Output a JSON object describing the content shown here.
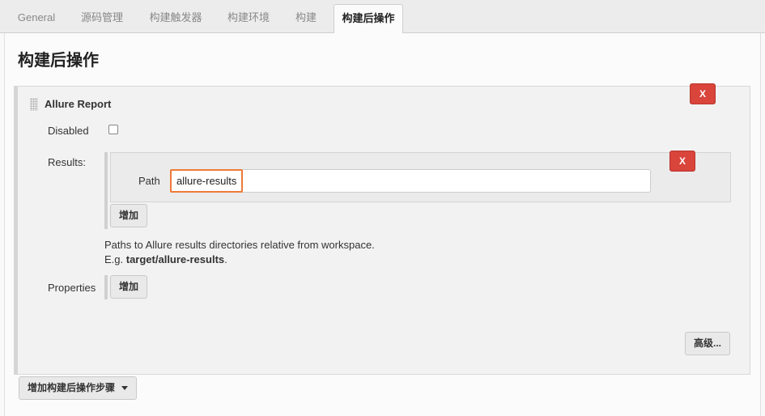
{
  "tabs": [
    {
      "label": "General",
      "active": false
    },
    {
      "label": "源码管理",
      "active": false
    },
    {
      "label": "构建触发器",
      "active": false
    },
    {
      "label": "构建环境",
      "active": false
    },
    {
      "label": "构建",
      "active": false
    },
    {
      "label": "构建后操作",
      "active": true
    }
  ],
  "section": {
    "title": "构建后操作"
  },
  "builder": {
    "title": "Allure Report",
    "delete_label": "X",
    "disabled_label": "Disabled",
    "disabled_checked": false,
    "results": {
      "label": "Results:",
      "delete_label": "X",
      "path_label": "Path",
      "path_value": "allure-results",
      "add_label": "增加",
      "help_line1": "Paths to Allure results directories relative from workspace.",
      "help_line2_prefix": "E.g. ",
      "help_line2_bold": "target/allure-results",
      "help_line2_suffix": "."
    },
    "properties": {
      "label": "Properties",
      "add_label": "增加"
    },
    "advanced_label": "高级..."
  },
  "footer": {
    "add_step_label": "增加构建后操作步骤"
  },
  "colors": {
    "delete_button": "#d9443b",
    "focus_outline": "#ee7a38",
    "tab_bar": "#ececec"
  }
}
